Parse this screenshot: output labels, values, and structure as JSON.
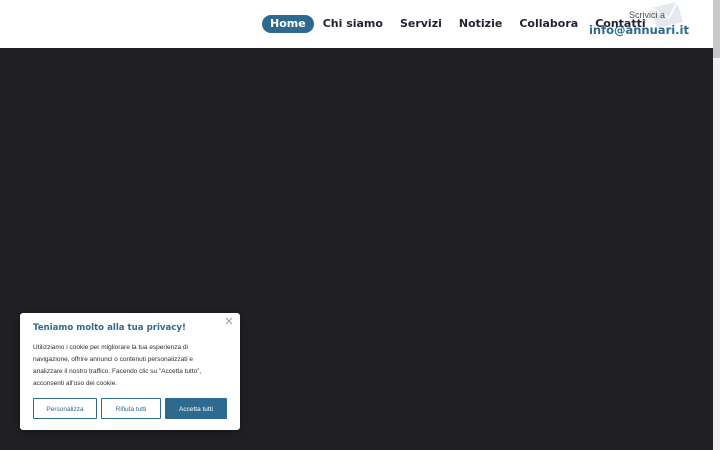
{
  "nav": {
    "items": [
      {
        "label": "Home",
        "active": true
      },
      {
        "label": "Chi siamo",
        "active": false
      },
      {
        "label": "Servizi",
        "active": false
      },
      {
        "label": "Notizie",
        "active": false
      },
      {
        "label": "Collabora",
        "active": false
      },
      {
        "label": "Contatti",
        "active": false
      }
    ]
  },
  "contact": {
    "label": "Scrivici a",
    "email": "info@annuari.it",
    "icon": "mail-icon"
  },
  "cookie_banner": {
    "title": "Teniamo molto alla tua privacy!",
    "text": "Utilizziamo i cookie per migliorare la tua esperienza di navigazione, offrire annunci o contenuti personalizzati e analizzare il nostro traffico. Facendo clic su “Accetta tutto”, acconsenti all'uso dei cookie.",
    "close_icon": "close-icon",
    "buttons": {
      "customize": "Personalizza",
      "reject": "Rifiuta tutti",
      "accept": "Accetta tutti"
    }
  },
  "colors": {
    "accent": "#2e6a8f",
    "hero_background": "#202024",
    "nav_text": "#1f2330"
  }
}
